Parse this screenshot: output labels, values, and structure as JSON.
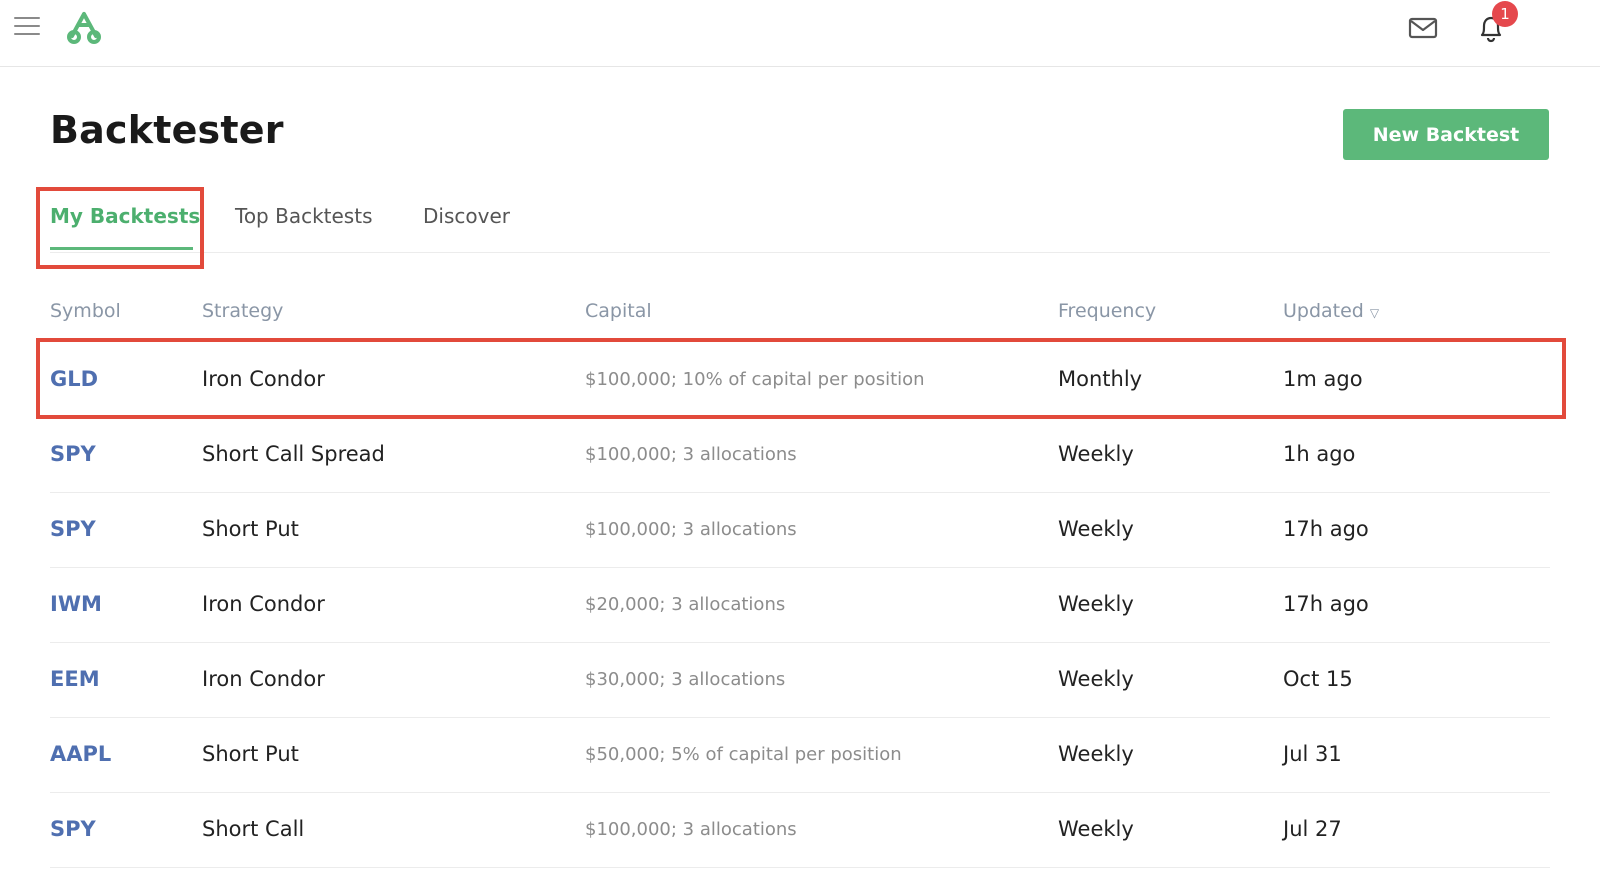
{
  "header": {
    "notification_count": "1",
    "icons": [
      "menu-icon",
      "logo-icon",
      "mail-icon",
      "bell-icon"
    ]
  },
  "page": {
    "title": "Backtester",
    "new_button_label": "New Backtest"
  },
  "tabs": [
    {
      "label": "My Backtests",
      "active": true
    },
    {
      "label": "Top Backtests",
      "active": false
    },
    {
      "label": "Discover",
      "active": false
    }
  ],
  "table": {
    "headers": {
      "symbol": "Symbol",
      "strategy": "Strategy",
      "capital": "Capital",
      "frequency": "Frequency",
      "updated": "Updated"
    },
    "sort_column": "updated",
    "rows": [
      {
        "symbol": "GLD",
        "strategy": "Iron Condor",
        "capital": "$100,000; 10% of capital per position",
        "frequency": "Monthly",
        "updated": "1m ago"
      },
      {
        "symbol": "SPY",
        "strategy": "Short Call Spread",
        "capital": "$100,000; 3 allocations",
        "frequency": "Weekly",
        "updated": "1h ago"
      },
      {
        "symbol": "SPY",
        "strategy": "Short Put",
        "capital": "$100,000; 3 allocations",
        "frequency": "Weekly",
        "updated": "17h ago"
      },
      {
        "symbol": "IWM",
        "strategy": "Iron Condor",
        "capital": "$20,000; 3 allocations",
        "frequency": "Weekly",
        "updated": "17h ago"
      },
      {
        "symbol": "EEM",
        "strategy": "Iron Condor",
        "capital": "$30,000; 3 allocations",
        "frequency": "Weekly",
        "updated": "Oct 15"
      },
      {
        "symbol": "AAPL",
        "strategy": "Short Put",
        "capital": "$50,000; 5% of capital per position",
        "frequency": "Weekly",
        "updated": "Jul 31"
      },
      {
        "symbol": "SPY",
        "strategy": "Short Call",
        "capital": "$100,000; 3 allocations",
        "frequency": "Weekly",
        "updated": "Jul 27"
      }
    ]
  },
  "colors": {
    "accent_green": "#5cb87a",
    "symbol_blue": "#4f6fb0",
    "highlight_red": "#e24a3b",
    "badge_red": "#e5484d"
  }
}
